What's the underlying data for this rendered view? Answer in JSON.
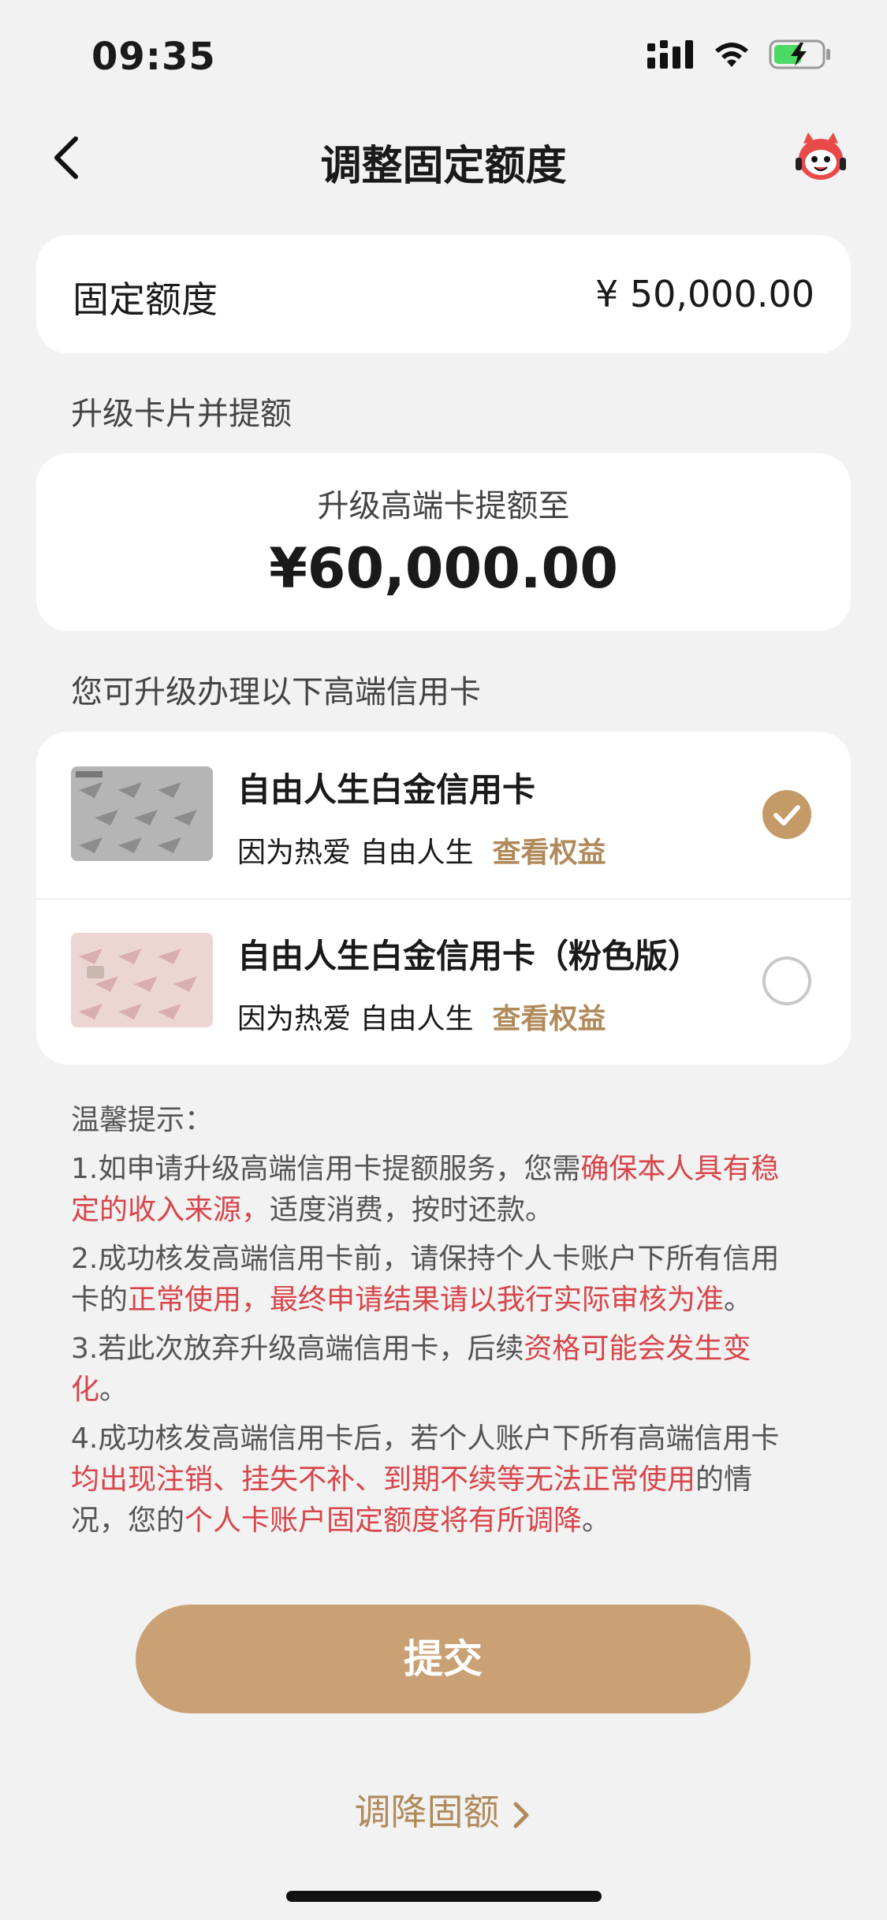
{
  "status": {
    "time": "09:35"
  },
  "nav": {
    "title": "调整固定额度"
  },
  "fixed": {
    "label": "固定额度",
    "value": "¥ 50,000.00"
  },
  "upgrade": {
    "section_title": "升级卡片并提额",
    "subtitle": "升级高端卡提额至",
    "amount": "¥60,000.00"
  },
  "cards": {
    "section_title": "您可升级办理以下高端信用卡",
    "items": [
      {
        "title": "自由人生白金信用卡",
        "desc": "因为热爱 自由人生",
        "link": "查看权益",
        "selected": true
      },
      {
        "title": "自由人生白金信用卡（粉色版）",
        "desc": "因为热爱 自由人生",
        "link": "查看权益",
        "selected": false
      }
    ]
  },
  "tips": {
    "heading": "温馨提示：",
    "t1a": "1.如申请升级高端信用卡提额服务，您需",
    "t1b": "确保本人具有稳定的收入来源，",
    "t1c": "适度消费，按时还款。",
    "t2a": "2.成功核发高端信用卡前，请保持个人卡账户下所有信用卡的",
    "t2b": "正常使用，最终申请结果请以我行实际审核为准",
    "t2c": "。",
    "t3a": "3.若此次放弃升级高端信用卡，后续",
    "t3b": "资格可能会发生变化",
    "t3c": "。",
    "t4a": "4.成功核发高端信用卡后，若个人账户下所有高端信用卡",
    "t4b": "均出现注销、挂失不补、到期不续等无法正常使用",
    "t4c": "的情况，您的",
    "t4d": "个人卡账户固定额度将有所调降",
    "t4e": "。"
  },
  "actions": {
    "submit": "提交",
    "lower": "调降固额"
  },
  "colors": {
    "accent": "#c9a174",
    "link": "#b08a5a",
    "warning": "#d8454a"
  }
}
